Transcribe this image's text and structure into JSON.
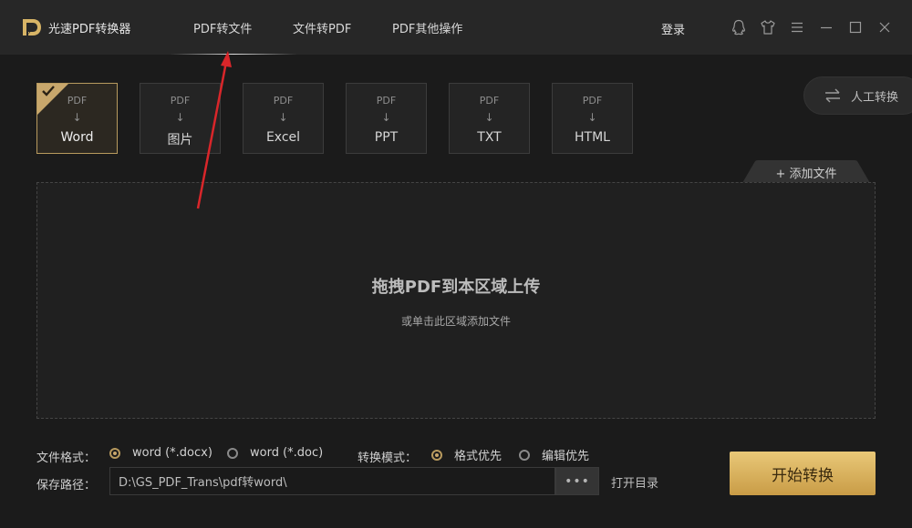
{
  "app": {
    "title": "光速PDF转换器"
  },
  "nav": [
    {
      "label": "PDF转文件",
      "active": true
    },
    {
      "label": "文件转PDF",
      "active": false
    },
    {
      "label": "PDF其他操作",
      "active": false
    }
  ],
  "header": {
    "login": "登录"
  },
  "window_icons": [
    "qq-icon",
    "shirt-icon",
    "menu-icon",
    "minimize-icon",
    "maximize-icon",
    "close-icon"
  ],
  "formats": [
    {
      "top": "PDF",
      "label": "Word",
      "selected": true
    },
    {
      "top": "PDF",
      "label": "图片",
      "selected": false
    },
    {
      "top": "PDF",
      "label": "Excel",
      "selected": false
    },
    {
      "top": "PDF",
      "label": "PPT",
      "selected": false
    },
    {
      "top": "PDF",
      "label": "TXT",
      "selected": false
    },
    {
      "top": "PDF",
      "label": "HTML",
      "selected": false
    }
  ],
  "manual": {
    "label": "人工转换"
  },
  "add_file": {
    "label": "添加文件",
    "icon": "+"
  },
  "dropzone": {
    "title": "拖拽PDF到本区域上传",
    "subtitle": "或单击此区域添加文件"
  },
  "options": {
    "format_label": "文件格式：",
    "format_options": [
      {
        "label": "word (*.docx)",
        "checked": true
      },
      {
        "label": "word (*.doc)",
        "checked": false
      }
    ],
    "mode_label": "转换模式：",
    "mode_options": [
      {
        "label": "格式优先",
        "checked": true
      },
      {
        "label": "编辑优先",
        "checked": false
      }
    ],
    "path_label": "保存路径：",
    "path_value": "D:\\GS_PDF_Trans\\pdf转word\\",
    "browse": "•••",
    "open_dir": "打开目录"
  },
  "start": {
    "label": "开始转换"
  },
  "colors": {
    "accent": "#c8a76c",
    "button": "#d9b25e",
    "arrow": "#d9262a"
  }
}
